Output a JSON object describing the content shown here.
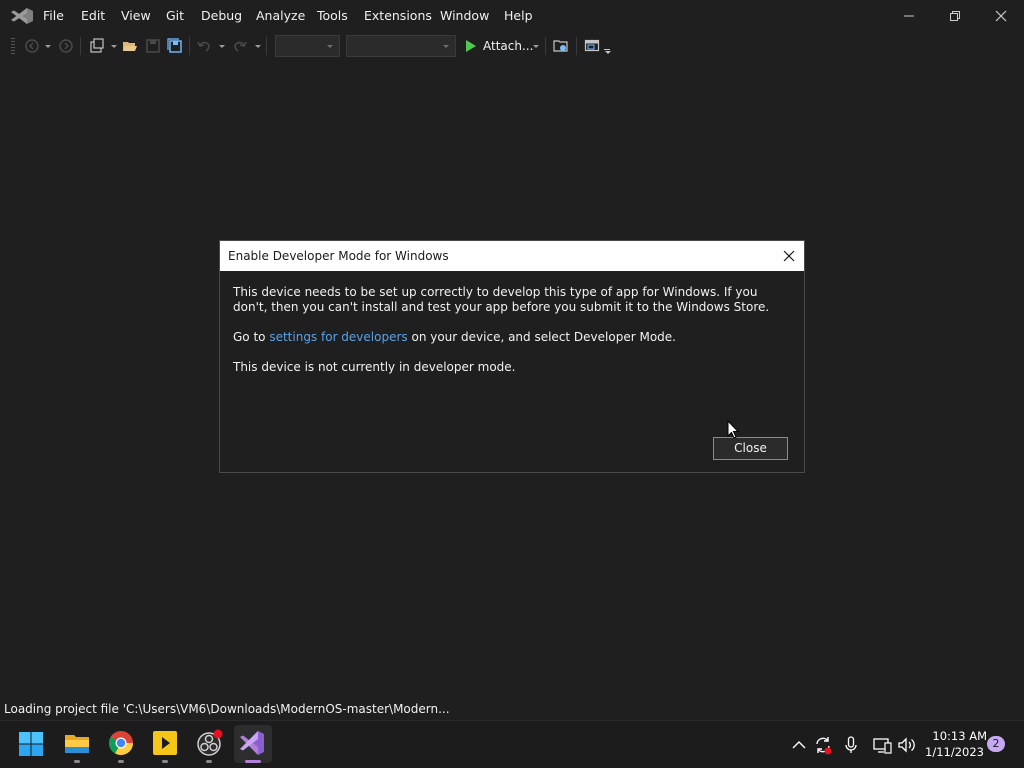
{
  "app": {
    "logo": "visual-studio-logo"
  },
  "menu": {
    "items": [
      {
        "label": "File"
      },
      {
        "label": "Edit"
      },
      {
        "label": "View"
      },
      {
        "label": "Git"
      },
      {
        "label": "Debug"
      },
      {
        "label": "Analyze"
      },
      {
        "label": "Tools"
      },
      {
        "label": "Extensions"
      },
      {
        "label": "Window"
      },
      {
        "label": "Help"
      }
    ]
  },
  "window_controls": {
    "minimize": "minimize-icon",
    "restore": "restore-icon",
    "close": "close-icon"
  },
  "toolbar": {
    "attach_label": "Attach...",
    "icons": [
      "nav-back-icon",
      "nav-forward-icon",
      "new-project-icon",
      "open-folder-icon",
      "save-icon",
      "save-all-icon",
      "undo-icon",
      "redo-icon",
      "play-icon",
      "browse-folder-icon",
      "layout-icon"
    ],
    "configuration_combo": "",
    "platform_combo": ""
  },
  "dialog": {
    "title": "Enable Developer Mode for Windows",
    "paragraph1": "This device needs to be set up correctly to develop this type of app for Windows. If you don't, then you can't install and test your app before you submit it to the Windows Store.",
    "p2_prefix": "Go to ",
    "p2_link": "settings for developers",
    "p2_suffix": " on your device, and select Developer Mode.",
    "paragraph3": "This device is not currently in developer mode.",
    "close_label": "Close",
    "link_color": "#5aa2e8"
  },
  "status_bar": {
    "text": "Loading project file 'C:\\Users\\VM6\\Downloads\\ModernOS-master\\Modern..."
  },
  "taskbar": {
    "apps": [
      "windows-start-icon",
      "file-explorer-icon",
      "chrome-icon",
      "media-app-icon",
      "obs-icon",
      "visual-studio-icon"
    ],
    "tray_icons": [
      "chevron-up-icon",
      "sync-icon",
      "microphone-icon",
      "network-icon",
      "volume-icon"
    ],
    "time": "10:13 AM",
    "date": "1/11/2023",
    "notification_count": "2",
    "accent_color": "#b180d7"
  }
}
